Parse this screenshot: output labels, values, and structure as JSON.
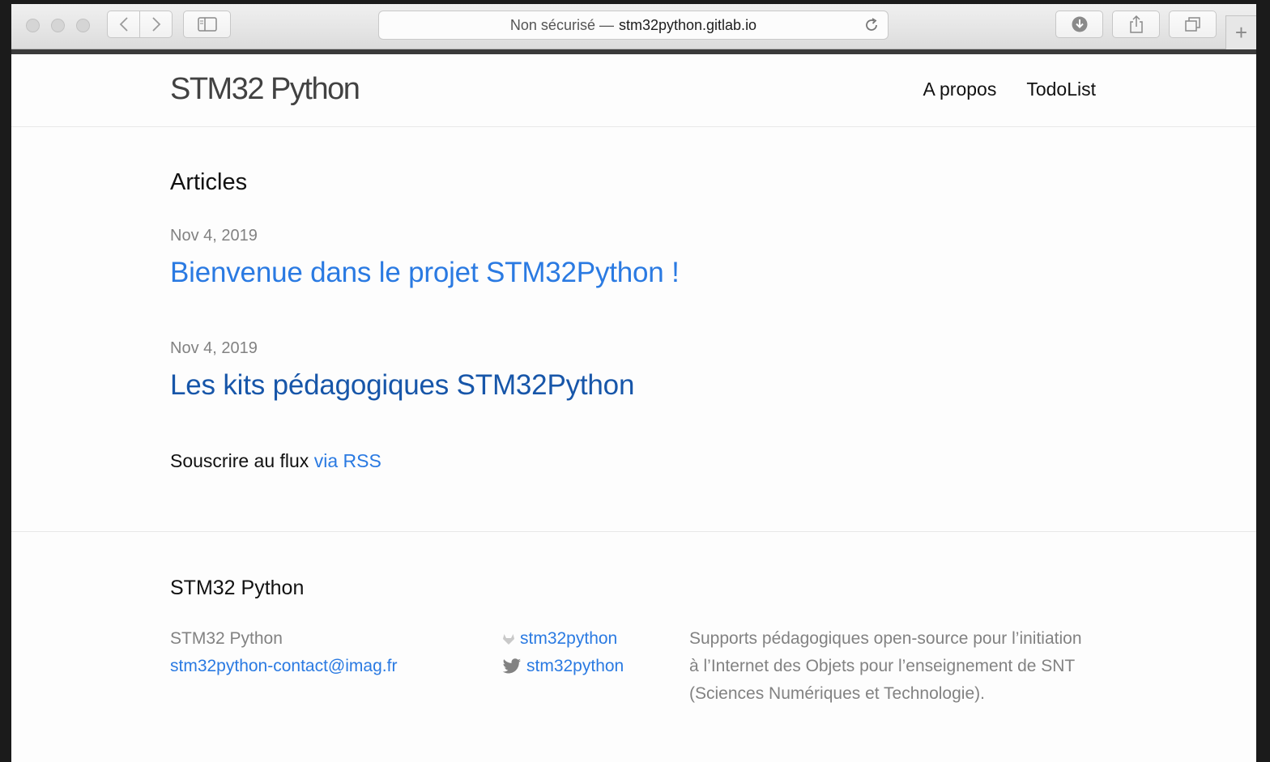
{
  "browser": {
    "url_prefix": "Non sécurisé —",
    "url_host": "stm32python.gitlab.io",
    "new_tab_label": "+"
  },
  "header": {
    "site_title": "STM32 Python",
    "nav": [
      "A propos",
      "TodoList"
    ]
  },
  "main": {
    "heading": "Articles",
    "posts": [
      {
        "date": "Nov 4, 2019",
        "title": "Bienvenue dans le projet STM32Python !"
      },
      {
        "date": "Nov 4, 2019",
        "title": "Les kits pédagogiques STM32Python"
      }
    ],
    "rss_text": "Souscrire au flux",
    "rss_link": "via RSS"
  },
  "footer": {
    "heading": "STM32 Python",
    "name": "STM32 Python",
    "email": "stm32python-contact@imag.fr",
    "gitlab_user": "stm32python",
    "twitter_user": "stm32python",
    "description": "Supports pédagogiques open-source pour l’initiation à l’Internet des Objets pour l’enseignement de SNT (Sciences Numériques et Technologie)."
  },
  "colors": {
    "link": "#2a7ae2",
    "visited_link": "#1756a9",
    "meta_text": "#828282",
    "twitter_icon": "#828282"
  },
  "icons": [
    "back-icon",
    "forward-icon",
    "sidebar-icon",
    "reload-icon",
    "download-icon",
    "share-icon",
    "tabs-icon",
    "gitlab-icon",
    "twitter-icon"
  ]
}
